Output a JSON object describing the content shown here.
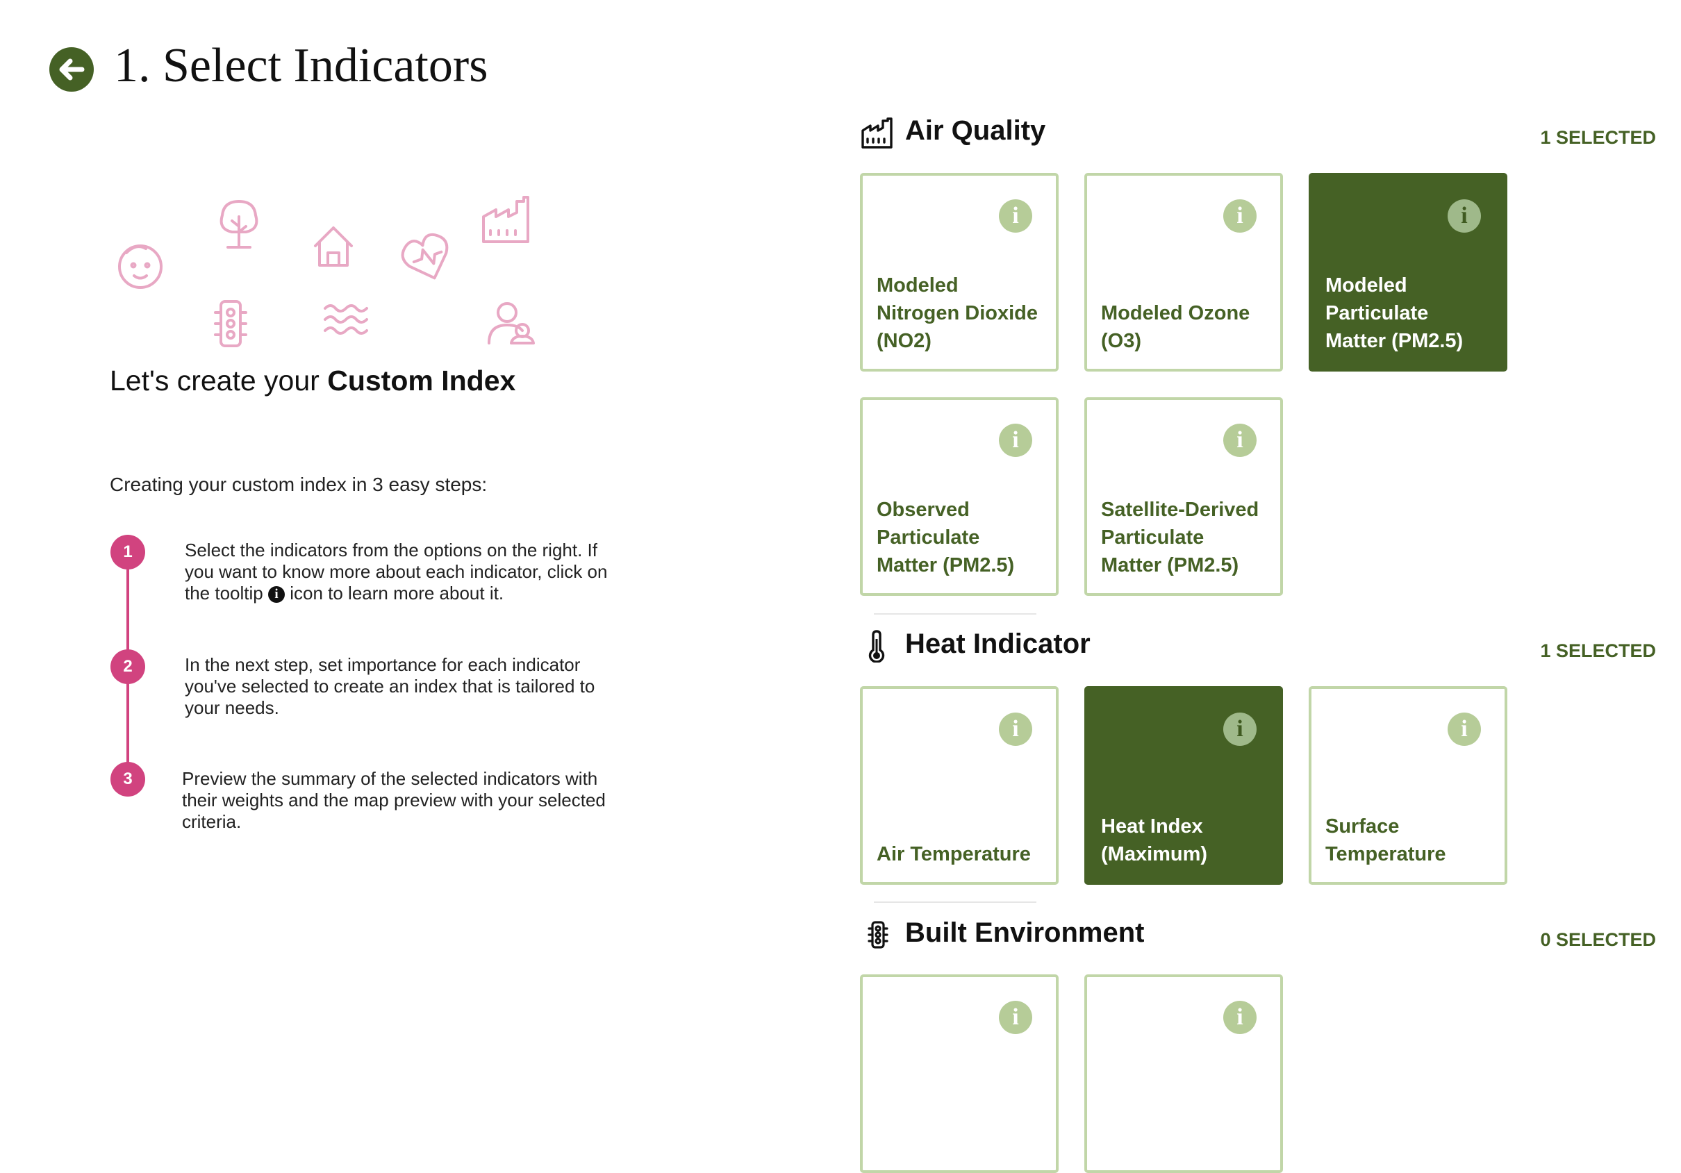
{
  "header": {
    "title": "1. Select Indicators",
    "back_icon": "arrow-left-circle-icon"
  },
  "intro": {
    "prefix": "Let's create your ",
    "emphasis": "Custom Index",
    "illustration_icons": [
      "baby-face-icon",
      "tree-icon",
      "house-icon",
      "heart-icon",
      "factory-icon",
      "traffic-light-icon",
      "waves-icon",
      "people-icon"
    ],
    "illustration_color": "#e8a8c4"
  },
  "steps": {
    "heading": "Creating your custom index in 3 easy steps:",
    "items": [
      {
        "num": "1",
        "text_before": "Select the indicators from the options on the right. If you want to know more about each indicator, click on the tooltip",
        "text_after": "icon to learn more about it."
      },
      {
        "num": "2",
        "text": "In the next step, set importance for each indicator you've selected to create an index that is tailored to your needs."
      },
      {
        "num": "3",
        "text": "Preview the summary of the selected indicators with their weights and the map preview with your selected criteria."
      }
    ],
    "accent_color": "#d1437f"
  },
  "colors": {
    "brand_green": "#456125",
    "card_border": "#c1d6a8",
    "info_icon": "#b6cc98"
  },
  "sections": [
    {
      "title": "Air Quality",
      "icon": "factory-icon",
      "count_label": "1 SELECTED",
      "cards": [
        {
          "label": "Modeled Nitrogen Dioxide (NO2)",
          "selected": false
        },
        {
          "label": "Modeled Ozone (O3)",
          "selected": false
        },
        {
          "label": "Modeled Particulate Matter (PM2.5)",
          "selected": true
        },
        {
          "label": "Observed Particulate Matter (PM2.5)",
          "selected": false
        },
        {
          "label": "Satellite-Derived Particulate Matter (PM2.5)",
          "selected": false
        }
      ]
    },
    {
      "title": "Heat Indicator",
      "icon": "thermometer-icon",
      "count_label": "1 SELECTED",
      "cards": [
        {
          "label": "Air Temperature",
          "selected": false
        },
        {
          "label": "Heat Index (Maximum)",
          "selected": true
        },
        {
          "label": "Surface Temperature",
          "selected": false
        }
      ]
    },
    {
      "title": "Built Environment",
      "icon": "traffic-light-icon",
      "count_label": "0 SELECTED",
      "cards": [
        {
          "label": "",
          "selected": false
        },
        {
          "label": "",
          "selected": false
        }
      ]
    }
  ],
  "info_glyph": "i"
}
